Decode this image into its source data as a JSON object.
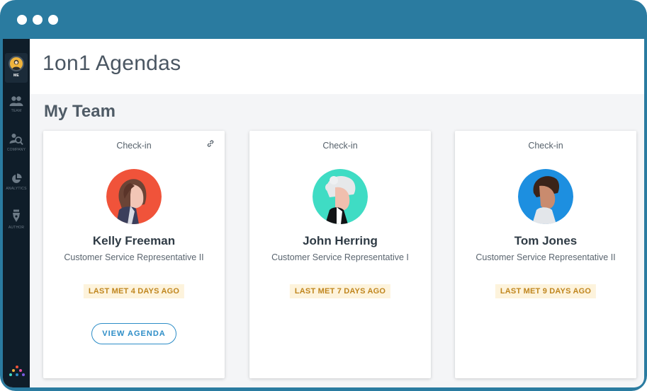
{
  "window": {
    "controls": [
      "window-dot",
      "window-dot",
      "window-dot"
    ],
    "frame_color": "#2a7ba0"
  },
  "sidebar": {
    "items": [
      {
        "label": "ME",
        "icon": "user-avatar-icon",
        "active": true
      },
      {
        "label": "TEAM",
        "icon": "team-icon",
        "active": false
      },
      {
        "label": "COMPANY",
        "icon": "company-search-icon",
        "active": false
      },
      {
        "label": "ANALYTICS",
        "icon": "pie-chart-icon",
        "active": false
      },
      {
        "label": "AUTHOR",
        "icon": "pen-nib-icon",
        "active": false
      }
    ],
    "logo": "app-logo-icon"
  },
  "header": {
    "title": "1on1 Agendas"
  },
  "section": {
    "title": "My Team"
  },
  "cards": [
    {
      "type": "Check-in",
      "name": "Kelly Freeman",
      "role": "Customer Service Representative II",
      "last_met": "LAST MET 4 DAYS AGO",
      "action": "VIEW AGENDA",
      "avatar_bg": "#f0533a",
      "has_link": true
    },
    {
      "type": "Check-in",
      "name": "John Herring",
      "role": "Customer Service Representative I",
      "last_met": "LAST MET 7 DAYS AGO",
      "avatar_bg": "#3fdcc4",
      "has_link": false
    },
    {
      "type": "Check-in",
      "name": "Tom Jones",
      "role": "Customer Service Representative II",
      "last_met": "LAST MET 9 DAYS AGO",
      "avatar_bg": "#1d8fe0",
      "has_link": false
    }
  ],
  "colors": {
    "accent": "#2d8dc7",
    "badge_bg": "#fdf3dc",
    "badge_text": "#c0861e",
    "sidebar_bg": "#0f1d29"
  }
}
